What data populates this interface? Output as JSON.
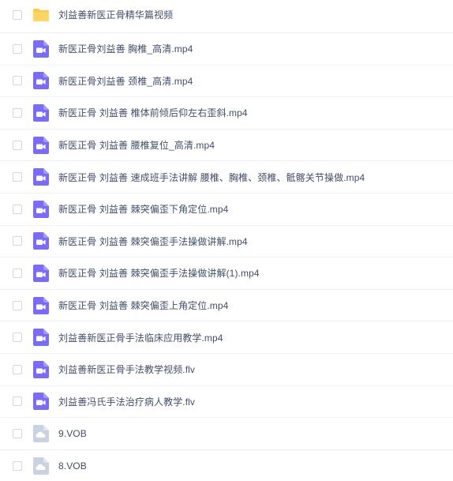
{
  "files": [
    {
      "name": "刘益善新医正骨精华篇视频",
      "icon": "folder-icon",
      "type": "folder"
    },
    {
      "name": "新医正骨刘益善 胸椎_高清.mp4",
      "icon": "video-file-icon",
      "type": "video"
    },
    {
      "name": "新医正骨刘益善 颈椎_高清.mp4",
      "icon": "video-file-icon",
      "type": "video"
    },
    {
      "name": "新医正骨 刘益善 椎体前倾后仰左右歪斜.mp4",
      "icon": "video-file-icon",
      "type": "video"
    },
    {
      "name": "新医正骨 刘益善 腰椎复位_高清.mp4",
      "icon": "video-file-icon",
      "type": "video"
    },
    {
      "name": "新医正骨 刘益善 速成班手法讲解 腰椎、胸椎、颈椎、骶髂关节操做.mp4",
      "icon": "video-file-icon",
      "type": "video"
    },
    {
      "name": "新医正骨 刘益善 棘突偏歪下角定位.mp4",
      "icon": "video-file-icon",
      "type": "video"
    },
    {
      "name": "新医正骨 刘益善 棘突偏歪手法操做讲解.mp4",
      "icon": "video-file-icon",
      "type": "video"
    },
    {
      "name": "新医正骨 刘益善 棘突偏歪手法操做讲解(1).mp4",
      "icon": "video-file-icon",
      "type": "video"
    },
    {
      "name": "新医正骨 刘益善 棘突偏歪上角定位.mp4",
      "icon": "video-file-icon",
      "type": "video"
    },
    {
      "name": "刘益善新医正骨手法临床应用教学.mp4",
      "icon": "video-file-icon",
      "type": "video"
    },
    {
      "name": "刘益善新医正骨手法教学视频.flv",
      "icon": "video-file-icon",
      "type": "video"
    },
    {
      "name": "刘益善冯氏手法治疗病人教学.flv",
      "icon": "video-file-icon",
      "type": "video"
    },
    {
      "name": "9.VOB",
      "icon": "cloud-file-icon",
      "type": "other"
    },
    {
      "name": "8.VOB",
      "icon": "cloud-file-icon",
      "type": "other"
    }
  ],
  "colors": {
    "folder": "#ffc94d",
    "video": "#7b6cf6",
    "cloud": "#c9d2de",
    "text": "#424e67",
    "divider": "#f1f2f5"
  }
}
